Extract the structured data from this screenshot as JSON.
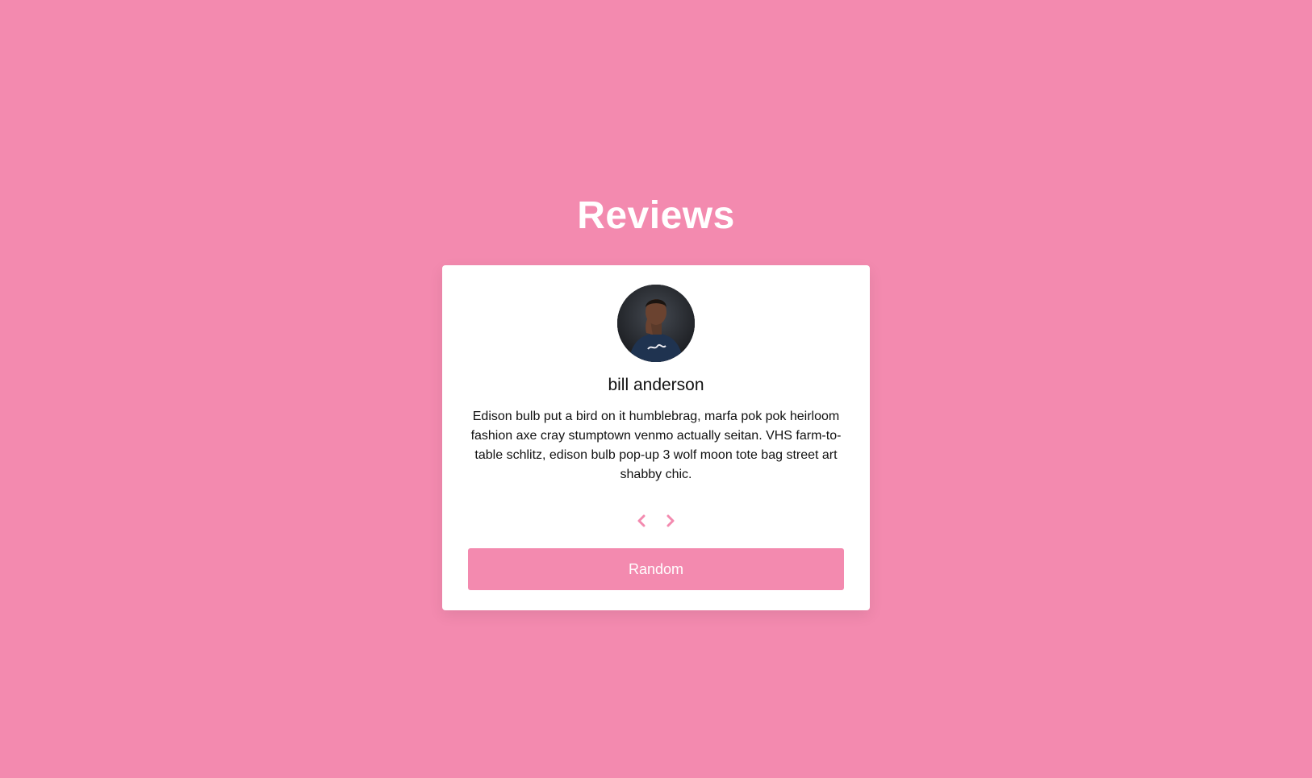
{
  "header": {
    "title": "Reviews"
  },
  "review_card": {
    "avatar_icon": "person-portrait",
    "name": "bill anderson",
    "text": "Edison bulb put a bird on it humblebrag, marfa pok pok heirloom fashion axe cray stumptown venmo actually seitan. VHS farm-to-table schlitz, edison bulb pop-up 3 wolf moon tote bag street art shabby chic.",
    "prev_icon": "chevron-left-icon",
    "next_icon": "chevron-right-icon",
    "random_label": "Random"
  },
  "colors": {
    "background": "#f38aaf",
    "card": "#ffffff",
    "accent": "#f38aaf",
    "text": "#111111"
  }
}
